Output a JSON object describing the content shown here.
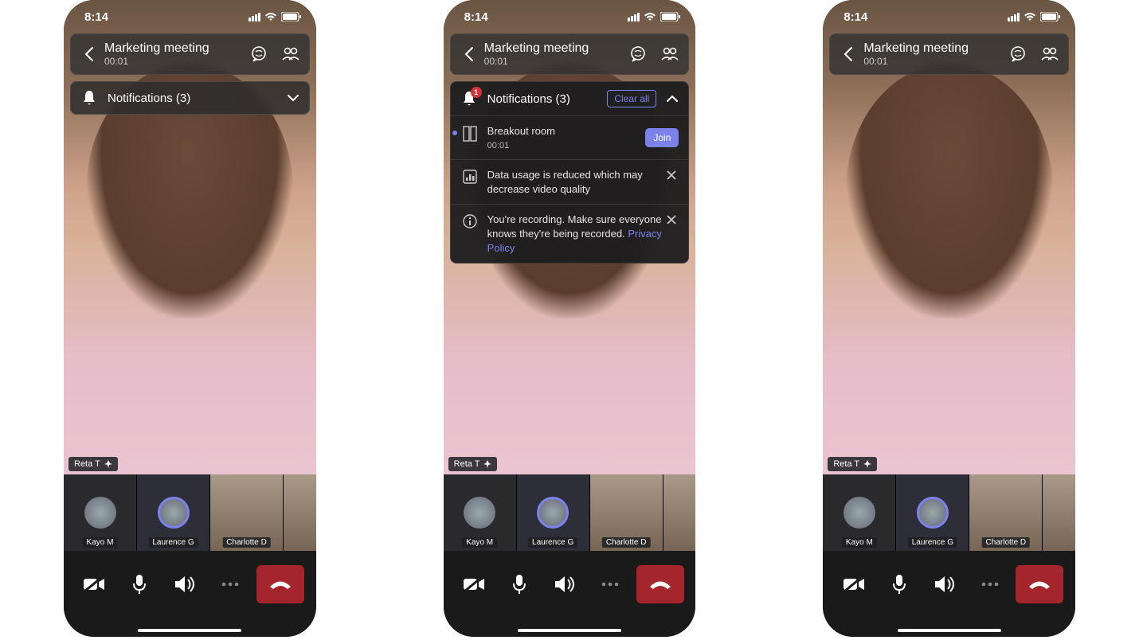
{
  "status": {
    "time": "8:14"
  },
  "meeting": {
    "title": "Marketing meeting",
    "elapsed": "00:01"
  },
  "notifications": {
    "collapsed_label": "Notifications (3)",
    "expanded_label": "Notifications (3)",
    "clear_label": "Clear all",
    "badge": "1",
    "items": [
      {
        "title": "Breakout room",
        "sub": "00:01",
        "action": "Join"
      },
      {
        "text": "Data usage is reduced which may decrease video quality"
      },
      {
        "text": "You're recording. Make sure everyone knows they're being recorded. ",
        "link": "Privacy Policy"
      }
    ]
  },
  "pinned": {
    "name": "Reta T"
  },
  "participants": [
    {
      "name": "Kayo M"
    },
    {
      "name": "Laurence G"
    },
    {
      "name": "Charlotte D"
    },
    {
      "name": ""
    }
  ]
}
